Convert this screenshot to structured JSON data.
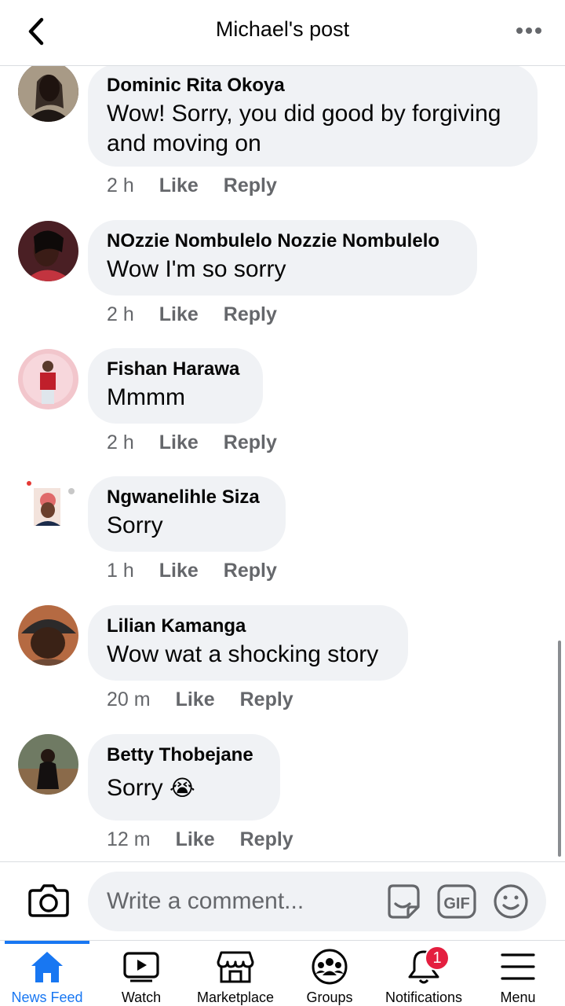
{
  "header": {
    "title": "Michael's post"
  },
  "comments": [
    {
      "author": "Dominic Rita Okoya",
      "text": "Wow! Sorry, you did good by forgiving and moving on",
      "time": "2 h",
      "like": "Like",
      "reply": "Reply"
    },
    {
      "author": "NOzzie Nombulelo Nozzie Nombulelo",
      "text": "Wow I'm so sorry",
      "time": "2 h",
      "like": "Like",
      "reply": "Reply"
    },
    {
      "author": "Fishan Harawa",
      "text": "Mmmm",
      "time": "2 h",
      "like": "Like",
      "reply": "Reply"
    },
    {
      "author": "Ngwanelihle Siza",
      "text": "Sorry",
      "time": "1 h",
      "like": "Like",
      "reply": "Reply"
    },
    {
      "author": "Lilian Kamanga",
      "text": "Wow wat a shocking story",
      "time": "20 m",
      "like": "Like",
      "reply": "Reply"
    },
    {
      "author": "Betty Thobejane",
      "text": "Sorry",
      "emoji": "😭",
      "time": "12 m",
      "like": "Like",
      "reply": "Reply"
    }
  ],
  "composer": {
    "placeholder": "Write a comment...",
    "gif_label": "GIF"
  },
  "nav": {
    "items": [
      {
        "label": "News Feed",
        "icon": "home-icon"
      },
      {
        "label": "Watch",
        "icon": "watch-icon"
      },
      {
        "label": "Marketplace",
        "icon": "marketplace-icon"
      },
      {
        "label": "Groups",
        "icon": "groups-icon"
      },
      {
        "label": "Notifications",
        "icon": "bell-icon",
        "badge": "1"
      },
      {
        "label": "Menu",
        "icon": "menu-icon"
      }
    ]
  },
  "colors": {
    "accent": "#1877f2",
    "bubble": "#f0f2f5",
    "meta": "#65676b",
    "badge": "#e41e3f"
  }
}
